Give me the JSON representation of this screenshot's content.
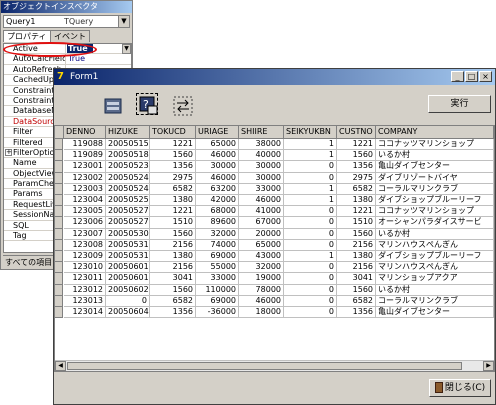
{
  "inspector": {
    "title": "オブジェクトインスペクタ",
    "component": "Query1",
    "component_type": "TQuery",
    "tabs": [
      "プロパティ",
      "イベント"
    ],
    "properties": [
      {
        "name": "Active",
        "value": "True",
        "selected": true,
        "dropdown": true
      },
      {
        "name": "AutoCalcFields",
        "value": "True"
      },
      {
        "name": "AutoRefresh",
        "value": ""
      },
      {
        "name": "CachedUpdates",
        "value": ""
      },
      {
        "name": "Constraints",
        "value": ""
      },
      {
        "name": "Constraints",
        "value": ""
      },
      {
        "name": "DatabaseName",
        "value": ""
      },
      {
        "name": "DataSource",
        "value": "",
        "red": true
      },
      {
        "name": "Filter",
        "value": ""
      },
      {
        "name": "Filtered",
        "value": ""
      },
      {
        "name": "FilterOptions",
        "value": "",
        "expandable": true
      },
      {
        "name": "Name",
        "value": ""
      },
      {
        "name": "ObjectView",
        "value": ""
      },
      {
        "name": "ParamCheck",
        "value": ""
      },
      {
        "name": "Params",
        "value": ""
      },
      {
        "name": "RequestLive",
        "value": ""
      },
      {
        "name": "SessionName",
        "value": ""
      },
      {
        "name": "SQL",
        "value": ""
      },
      {
        "name": "Tag",
        "value": ""
      }
    ],
    "footer": "すべての項目"
  },
  "form": {
    "title": "Form1",
    "titlebar_icon": "7",
    "window_buttons": [
      "_",
      "□",
      "×"
    ],
    "exec_label": "実行",
    "close_label": "閉じる(C)",
    "columns": [
      "DENNO",
      "HIZUKE",
      "TOKUCD",
      "URIAGE",
      "SHIIRE",
      "SEIKYUKBN",
      "CUSTNO",
      "COMPANY"
    ],
    "rows": [
      [
        "119088",
        "20050515",
        "1221",
        "65000",
        "38000",
        "1",
        "1221",
        "ココナッツマリンショップ"
      ],
      [
        "119089",
        "20050518",
        "1560",
        "46000",
        "40000",
        "1",
        "1560",
        "いるか村"
      ],
      [
        "123001",
        "20050523",
        "1356",
        "30000",
        "30000",
        "0",
        "1356",
        "亀山ダイブセンター"
      ],
      [
        "123002",
        "20050524",
        "2975",
        "46000",
        "30000",
        "0",
        "2975",
        "ダイブリゾートバイヤ"
      ],
      [
        "123003",
        "20050524",
        "6582",
        "63200",
        "33000",
        "1",
        "6582",
        "コーラルマリンクラブ"
      ],
      [
        "123004",
        "20050525",
        "1380",
        "42000",
        "46000",
        "1",
        "1380",
        "ダイブショップブルーリーフ"
      ],
      [
        "123005",
        "20050527",
        "1221",
        "68000",
        "41000",
        "0",
        "1221",
        "ココナッツマリンショップ"
      ],
      [
        "123006",
        "20050527",
        "1510",
        "89600",
        "67000",
        "0",
        "1510",
        "オーシャンパラダイスサービ"
      ],
      [
        "123007",
        "20050530",
        "1560",
        "32000",
        "20000",
        "0",
        "1560",
        "いるか村"
      ],
      [
        "123008",
        "20050531",
        "2156",
        "74000",
        "65000",
        "0",
        "2156",
        "マリンハウスぺんぎん"
      ],
      [
        "123009",
        "20050531",
        "1380",
        "69000",
        "43000",
        "1",
        "1380",
        "ダイブショップブルーリーフ"
      ],
      [
        "123010",
        "20050601",
        "2156",
        "55000",
        "32000",
        "0",
        "2156",
        "マリンハウスぺんぎん"
      ],
      [
        "123011",
        "20050601",
        "3041",
        "33000",
        "19000",
        "0",
        "3041",
        "マリンショップアクア"
      ],
      [
        "123012",
        "20050602",
        "1560",
        "110000",
        "78000",
        "0",
        "1560",
        "いるか村"
      ],
      [
        "123013",
        "0",
        "6582",
        "69000",
        "46000",
        "0",
        "6582",
        "コーラルマリンクラブ"
      ],
      [
        "123014",
        "20050604",
        "1356",
        "-36000",
        "18000",
        "0",
        "1356",
        "亀山ダイブセンター"
      ]
    ]
  }
}
